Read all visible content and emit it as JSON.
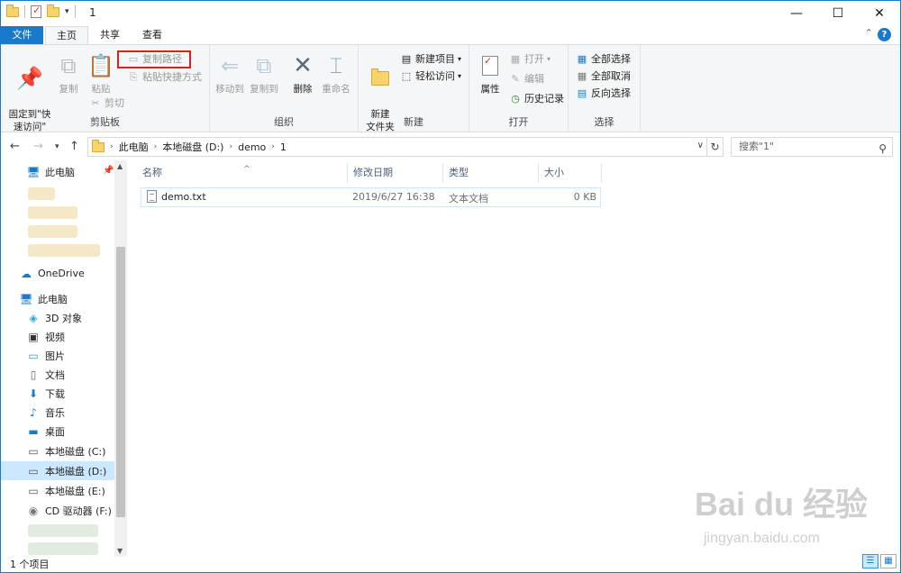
{
  "window": {
    "title": "1",
    "controls": {
      "minimize": "—",
      "maximize": "☐",
      "close": "✕"
    }
  },
  "ribbon_tabs": [
    "文件",
    "主页",
    "共享",
    "查看"
  ],
  "ribbon": {
    "clipboard": {
      "label": "剪贴板",
      "pin_quick": "固定到\"快\n速访问\"",
      "copy": "复制",
      "paste": "粘贴",
      "copy_path": "复制路径",
      "paste_shortcut": "粘贴快捷方式",
      "cut": "剪切"
    },
    "organize": {
      "label": "组织",
      "move_to": "移动到",
      "copy_to": "复制到",
      "delete": "删除",
      "rename": "重命名"
    },
    "new": {
      "label": "新建",
      "new_folder": "新建\n文件夹",
      "new_item": "新建项目",
      "easy_access": "轻松访问"
    },
    "open": {
      "label": "打开",
      "properties": "属性",
      "open": "打开",
      "edit": "编辑",
      "history": "历史记录"
    },
    "select": {
      "label": "选择",
      "select_all": "全部选择",
      "select_none": "全部取消",
      "invert": "反向选择"
    }
  },
  "address": {
    "crumbs": [
      "此电脑",
      "本地磁盘 (D:)",
      "demo",
      "1"
    ],
    "search_placeholder": "搜索\"1\""
  },
  "nav": {
    "quick_access": "此电脑",
    "onedrive": "OneDrive",
    "this_pc": "此电脑",
    "items": [
      "3D 对象",
      "视频",
      "图片",
      "文档",
      "下载",
      "音乐",
      "桌面",
      "本地磁盘 (C:)",
      "本地磁盘 (D:)",
      "本地磁盘 (E:)",
      "CD 驱动器 (F:)"
    ]
  },
  "columns": [
    "名称",
    "修改日期",
    "类型",
    "大小"
  ],
  "files": [
    {
      "name": "demo.txt",
      "modified": "2019/6/27 16:38",
      "type": "文本文档",
      "size": "0 KB"
    }
  ],
  "status": {
    "count": "1 个项目"
  },
  "watermark": {
    "brand": "Bai du 经验",
    "url": "jingyan.baidu.com"
  }
}
